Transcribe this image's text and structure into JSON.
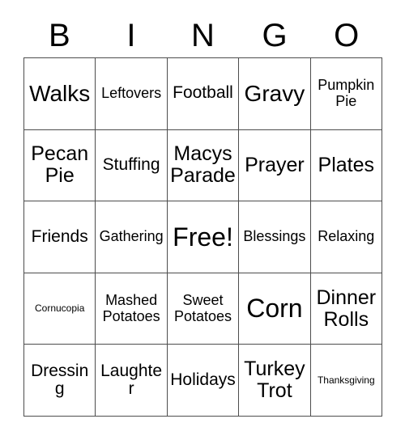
{
  "card": {
    "title": "BINGO",
    "header_letters": [
      "B",
      "I",
      "N",
      "G",
      "O"
    ],
    "colors": {
      "background": "#ffffff",
      "text": "#000000",
      "grid_line": "#4d4d4d"
    },
    "rows": [
      [
        {
          "text": "Walks",
          "size": "s-xxl"
        },
        {
          "text": "Leftovers",
          "size": "s-md"
        },
        {
          "text": "Football",
          "size": "s-lg"
        },
        {
          "text": "Gravy",
          "size": "s-xxl"
        },
        {
          "text": "Pumpkin Pie",
          "size": "s-md"
        }
      ],
      [
        {
          "text": "Pecan Pie",
          "size": "s-xl"
        },
        {
          "text": "Stuffing",
          "size": "s-lg"
        },
        {
          "text": "Macys Parade",
          "size": "s-xl"
        },
        {
          "text": "Prayer",
          "size": "s-xl"
        },
        {
          "text": "Plates",
          "size": "s-xl"
        }
      ],
      [
        {
          "text": "Friends",
          "size": "s-lg"
        },
        {
          "text": "Gathering",
          "size": "s-md"
        },
        {
          "text": "Free!",
          "size": "s-max"
        },
        {
          "text": "Blessings",
          "size": "s-md"
        },
        {
          "text": "Relaxing",
          "size": "s-md"
        }
      ],
      [
        {
          "text": "Cornucopia",
          "size": "s-xs"
        },
        {
          "text": "Mashed Potatoes",
          "size": "s-md"
        },
        {
          "text": "Sweet Potatoes",
          "size": "s-md"
        },
        {
          "text": "Corn",
          "size": "s-max"
        },
        {
          "text": "Dinner Rolls",
          "size": "s-xl"
        }
      ],
      [
        {
          "text": "Dressing",
          "size": "s-lg"
        },
        {
          "text": "Laughter",
          "size": "s-lg"
        },
        {
          "text": "Holidays",
          "size": "s-lg"
        },
        {
          "text": "Turkey Trot",
          "size": "s-xl"
        },
        {
          "text": "Thanksgiving",
          "size": "s-xs"
        }
      ]
    ]
  }
}
